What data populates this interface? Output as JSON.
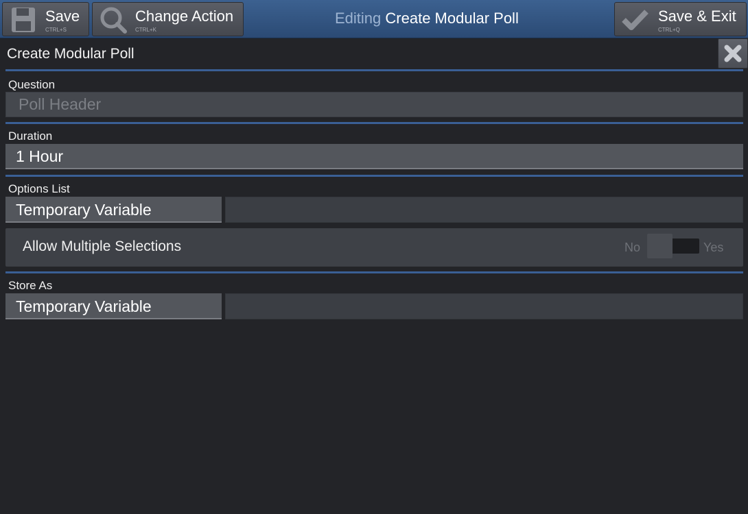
{
  "toolbar": {
    "save": {
      "label": "Save",
      "shortcut": "CTRL+S",
      "icon": "floppy-disk-icon"
    },
    "change_action": {
      "label": "Change Action",
      "shortcut": "CTRL+K",
      "icon": "magnifier-icon"
    },
    "save_exit": {
      "label": "Save & Exit",
      "shortcut": "CTRL+Q",
      "icon": "checkmark-icon"
    },
    "editing_prefix": "Editing",
    "editing_name": "Create Modular Poll"
  },
  "panel": {
    "title": "Create Modular Poll",
    "close_icon": "close-x-icon"
  },
  "fields": {
    "question": {
      "label": "Question",
      "value": "",
      "placeholder": "Poll Header"
    },
    "duration": {
      "label": "Duration",
      "value": "1 Hour"
    },
    "options_list": {
      "label": "Options List",
      "type": "Temporary Variable",
      "value": ""
    },
    "allow_multiple": {
      "label": "Allow Multiple Selections",
      "off_label": "No",
      "on_label": "Yes",
      "value": false
    },
    "store_as": {
      "label": "Store As",
      "type": "Temporary Variable",
      "value": ""
    }
  },
  "colors": {
    "toolbar_bg": "#34578a",
    "divider": "#3a5f95",
    "background": "#232428"
  }
}
